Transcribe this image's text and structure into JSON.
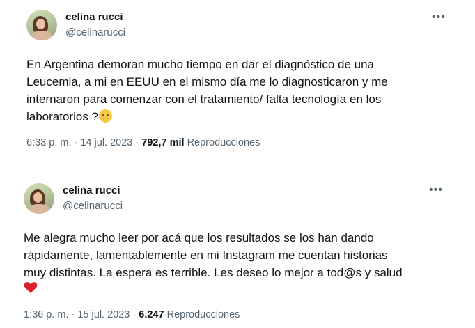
{
  "tweets": [
    {
      "name": "celina rucci",
      "handle": "@celinarucci",
      "more_icon": "•••",
      "text_lines": [
        "En Argentina demoran mucho tiempo en dar el diagnóstico de una",
        "Leucemia, a mi en EEUU en el mismo día me lo diagnosticaron y me",
        "internaron para comenzar con el tratamiento/  falta tecnología en los",
        "laboratorios ?"
      ],
      "emoji": "pleading-face-emoji",
      "time": "6:33 p. m.",
      "date": "14 jul. 2023",
      "separator": "·",
      "views": "792,7 mil",
      "views_label": "Reproducciones"
    },
    {
      "name": "celina rucci",
      "handle": "@celinarucci",
      "more_icon": "•••",
      "text_lines": [
        "Me alegra mucho leer por acá que los resultados se los han dando",
        "rápidamente, lamentablemente en mi Instagram me cuentan historias",
        "muy distintas. La espera es terrible. Les deseo lo mejor a tod@s y salud"
      ],
      "emoji": "red-heart-emoji",
      "emoji_color": "#d9222b",
      "time": "1:36 p. m.",
      "date": "15 jul. 2023",
      "separator": "·",
      "views": "6.247",
      "views_label": "Reproducciones"
    }
  ]
}
